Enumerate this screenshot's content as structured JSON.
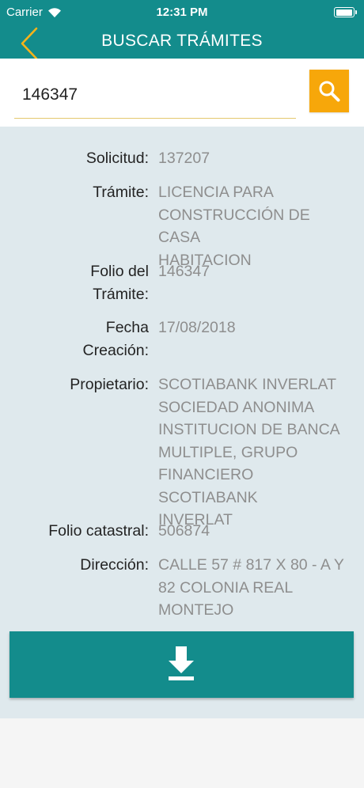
{
  "status_bar": {
    "carrier": "Carrier",
    "time": "12:31 PM"
  },
  "nav": {
    "title": "BUSCAR TRÁMITES",
    "back_icon": "chevron-left-icon"
  },
  "search": {
    "value": "146347",
    "button_icon": "search-icon"
  },
  "details": {
    "solicitud": {
      "label": "Solicitud:",
      "value": "137207"
    },
    "tramite": {
      "label": "Trámite:",
      "value": "LICENCIA PARA\nCONSTRUCCIÓN DE CASA\nHABITACION"
    },
    "folio_tramite": {
      "label": "Folio del\nTrámite:",
      "value": "146347"
    },
    "fecha_creacion": {
      "label": "Fecha\nCreación:",
      "value": "17/08/2018"
    },
    "propietario": {
      "label": "Propietario:",
      "value": "SCOTIABANK INVERLAT\nSOCIEDAD ANONIMA\nINSTITUCION DE BANCA\nMULTIPLE, GRUPO\nFINANCIERO SCOTIABANK\nINVERLAT"
    },
    "folio_catastral": {
      "label": "Folio catastral:",
      "value": "506874"
    },
    "direccion": {
      "label": "Dirección:",
      "value": "CALLE 57 # 817 X 80 - A Y\n82 COLONIA REAL\nMONTEJO"
    }
  },
  "download": {
    "icon": "download-icon"
  },
  "colors": {
    "header": "#138c8c",
    "accent": "#f7a70a",
    "content_bg": "#dfe9ed",
    "value_text": "#8e8e8e"
  }
}
